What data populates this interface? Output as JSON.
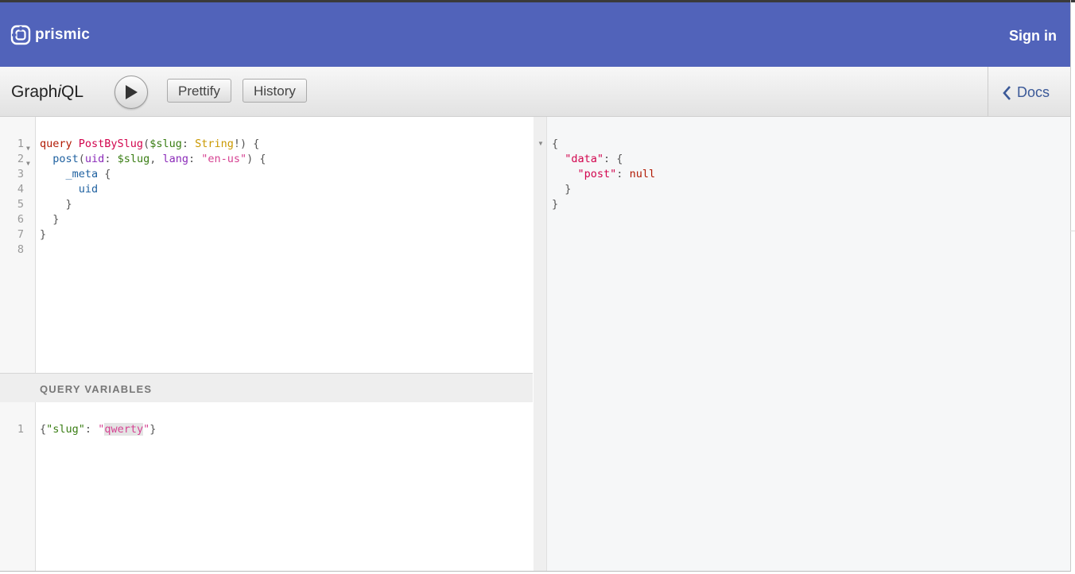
{
  "header": {
    "brand": "prismic",
    "sign_in": "Sign in"
  },
  "toolbar": {
    "title_pre": "Graph",
    "title_i": "i",
    "title_post": "QL",
    "prettify": "Prettify",
    "history": "History",
    "docs": "Docs"
  },
  "query_lines": [
    {
      "n": "1"
    },
    {
      "n": "2"
    },
    {
      "n": "3"
    },
    {
      "n": "4"
    },
    {
      "n": "5"
    },
    {
      "n": "6"
    },
    {
      "n": "7"
    },
    {
      "n": "8"
    }
  ],
  "query_text": {
    "kw_query": "query",
    "op_name": "PostBySlug",
    "var_slug": "$slug",
    "type_string": "String",
    "field_post": "post",
    "arg_uid": "uid",
    "arg_lang": "lang",
    "lang_value": "\"en-us\"",
    "field_meta": "_meta",
    "field_uid": "uid"
  },
  "variables": {
    "header": "QUERY VARIABLES",
    "line_num": "1",
    "key": "\"slug\"",
    "value_q": "\"",
    "value": "qwerty"
  },
  "result": {
    "key_data": "\"data\"",
    "key_post": "\"post\"",
    "val_null": "null"
  },
  "colors": {
    "header_bg": "#5163ba",
    "keyword": "#b11a04",
    "def": "#d2054e",
    "variable": "#397d13",
    "type": "#ca9800",
    "string": "#d64292"
  }
}
